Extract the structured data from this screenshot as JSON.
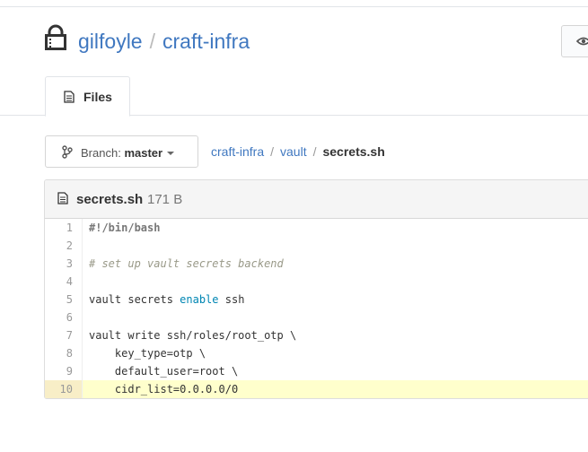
{
  "repo": {
    "owner": "gilfoyle",
    "separator": "/",
    "name": "craft-infra"
  },
  "tabs": [
    {
      "label": "Files",
      "icon": "file-icon",
      "active": true
    }
  ],
  "branch": {
    "label": "Branch:",
    "value": "master"
  },
  "breadcrumb": {
    "parts": [
      "craft-infra",
      "vault"
    ],
    "separator": "/",
    "current": "secrets.sh"
  },
  "file": {
    "name": "secrets.sh",
    "size": "171 B",
    "highlighted_line": 10,
    "lines": [
      {
        "number": "1",
        "segments": [
          {
            "text": "#!/bin/bash",
            "style": "shebang"
          }
        ]
      },
      {
        "number": "2",
        "segments": []
      },
      {
        "number": "3",
        "segments": [
          {
            "text": "# set up vault secrets backend",
            "style": "comment"
          }
        ]
      },
      {
        "number": "4",
        "segments": []
      },
      {
        "number": "5",
        "segments": [
          {
            "text": "vault secrets ",
            "style": "plain"
          },
          {
            "text": "enable",
            "style": "kw"
          },
          {
            "text": " ssh",
            "style": "plain"
          }
        ]
      },
      {
        "number": "6",
        "segments": []
      },
      {
        "number": "7",
        "segments": [
          {
            "text": "vault write ssh/roles/root_otp \\",
            "style": "plain"
          }
        ]
      },
      {
        "number": "8",
        "segments": [
          {
            "text": "    key_type=otp \\",
            "style": "plain"
          }
        ]
      },
      {
        "number": "9",
        "segments": [
          {
            "text": "    default_user=root \\",
            "style": "plain"
          }
        ]
      },
      {
        "number": "10",
        "segments": [
          {
            "text": "    cidr_list=0.0.0.0/0",
            "style": "plain"
          }
        ]
      }
    ]
  },
  "colors": {
    "link": "#4078c0",
    "highlight": "#ffffcc",
    "keyword": "#0086b3",
    "comment": "#999988"
  }
}
